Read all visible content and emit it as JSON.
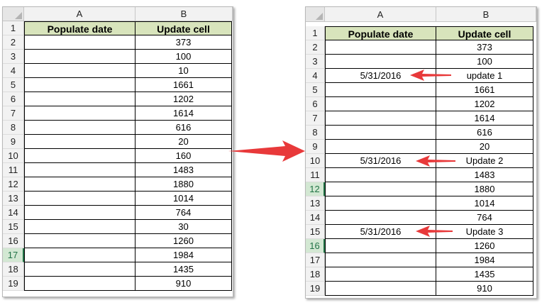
{
  "columns": [
    "A",
    "B"
  ],
  "header_row": {
    "a": "Populate date",
    "b": "Update cell"
  },
  "left_sheet": {
    "row_numbers": [
      "1",
      "2",
      "3",
      "4",
      "5",
      "6",
      "7",
      "8",
      "9",
      "10",
      "11",
      "12",
      "13",
      "14",
      "15",
      "16",
      "17",
      "18",
      "19"
    ],
    "selected_row": "17",
    "rows": [
      {
        "a": "",
        "b": "373"
      },
      {
        "a": "",
        "b": "100"
      },
      {
        "a": "",
        "b": "10"
      },
      {
        "a": "",
        "b": "1661"
      },
      {
        "a": "",
        "b": "1202"
      },
      {
        "a": "",
        "b": "1614"
      },
      {
        "a": "",
        "b": "616"
      },
      {
        "a": "",
        "b": "20"
      },
      {
        "a": "",
        "b": "160"
      },
      {
        "a": "",
        "b": "1483"
      },
      {
        "a": "",
        "b": "1880"
      },
      {
        "a": "",
        "b": "1014"
      },
      {
        "a": "",
        "b": "764"
      },
      {
        "a": "",
        "b": "30"
      },
      {
        "a": "",
        "b": "1260"
      },
      {
        "a": "",
        "b": "1984"
      },
      {
        "a": "",
        "b": "1435"
      },
      {
        "a": "",
        "b": "910"
      }
    ]
  },
  "right_sheet": {
    "row_numbers": [
      "1",
      "2",
      "3",
      "4",
      "5",
      "6",
      "7",
      "8",
      "9",
      "10",
      "11",
      "12",
      "13",
      "14",
      "15",
      "16",
      "17",
      "18",
      "19"
    ],
    "selected_rows": [
      "12",
      "16"
    ],
    "rows": [
      {
        "a": "",
        "b": "373"
      },
      {
        "a": "",
        "b": "100"
      },
      {
        "a": "5/31/2016",
        "b": "update 1"
      },
      {
        "a": "",
        "b": "1661"
      },
      {
        "a": "",
        "b": "1202"
      },
      {
        "a": "",
        "b": "1614"
      },
      {
        "a": "",
        "b": "616"
      },
      {
        "a": "",
        "b": "20"
      },
      {
        "a": "5/31/2016",
        "b": "Update 2"
      },
      {
        "a": "",
        "b": "1483"
      },
      {
        "a": "",
        "b": "1880"
      },
      {
        "a": "",
        "b": "1014"
      },
      {
        "a": "",
        "b": "764"
      },
      {
        "a": "5/31/2016",
        "b": "Update 3"
      },
      {
        "a": "",
        "b": "1260"
      },
      {
        "a": "",
        "b": "1984"
      },
      {
        "a": "",
        "b": "1435"
      },
      {
        "a": "",
        "b": "910"
      }
    ]
  },
  "colors": {
    "header_fill": "#d8e4bc",
    "arrow": "#e8393a",
    "selected_row_header": "#217346"
  }
}
